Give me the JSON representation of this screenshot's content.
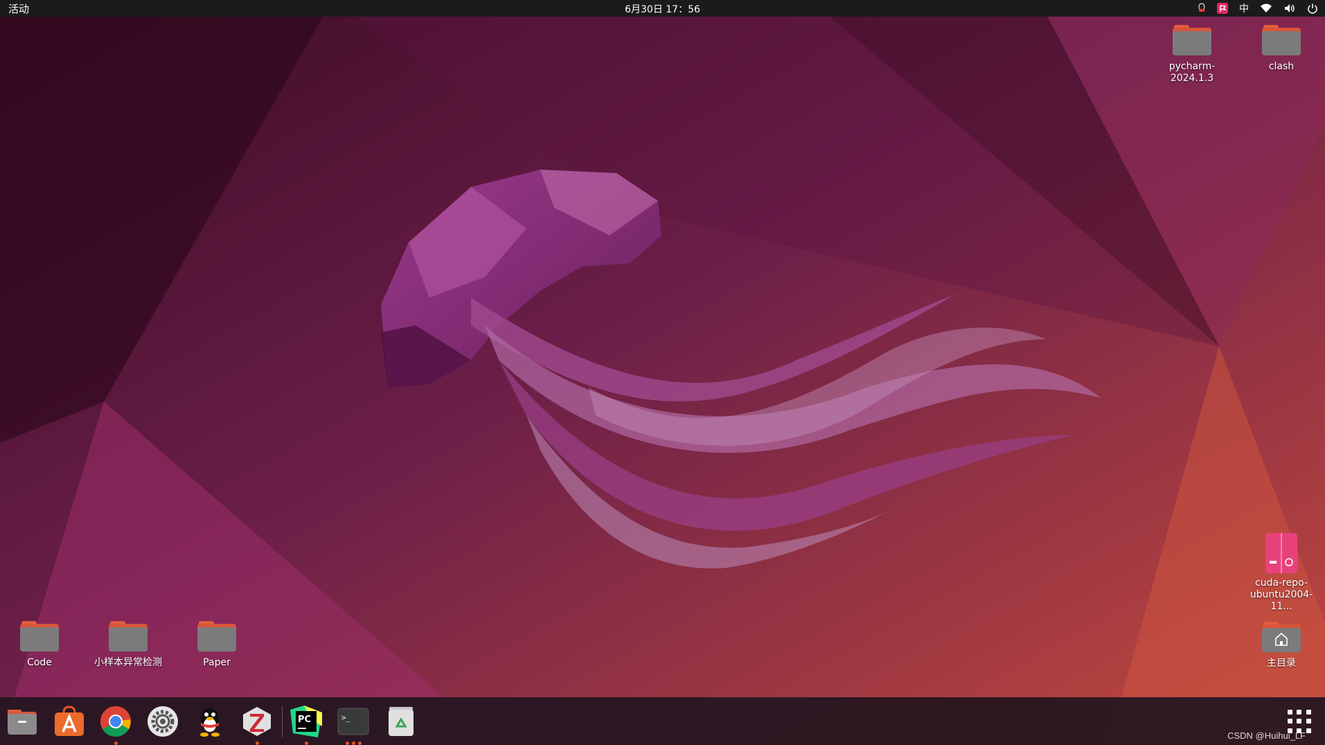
{
  "topbar": {
    "activities": "活动",
    "clock": "6月30日  17：56",
    "input_method": "中"
  },
  "desktop": {
    "top_right": [
      {
        "label": "pycharm-2024.1.3"
      },
      {
        "label": "clash"
      }
    ],
    "bottom_left": [
      {
        "label": "Code"
      },
      {
        "label": "小样本异常检测"
      },
      {
        "label": "Paper"
      }
    ],
    "cuda": {
      "label": "cuda-repo-ubuntu2004-11..."
    },
    "home": {
      "label": "主目录"
    }
  },
  "dock": {
    "items": [
      {
        "icon": "files-icon"
      },
      {
        "icon": "app-center-icon"
      },
      {
        "icon": "chrome-icon"
      },
      {
        "icon": "settings-icon"
      },
      {
        "icon": "qq-icon"
      },
      {
        "icon": "zotero-icon"
      },
      {
        "icon": "pycharm-icon"
      },
      {
        "icon": "terminal-icon"
      },
      {
        "icon": "trash-icon"
      }
    ],
    "pycharm_text": "PC",
    "terminal_prompt": ">_"
  },
  "watermark": "CSDN @Huihui_LF",
  "colors": {
    "accent": "#e95420",
    "wallpaper_dark": "#3a0a22",
    "wallpaper_light": "#c0483e"
  }
}
